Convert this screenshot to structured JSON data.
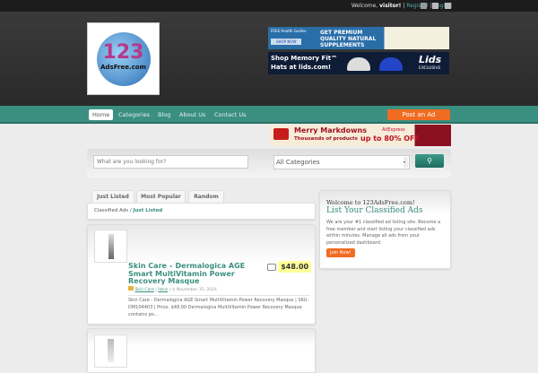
{
  "topbar": {
    "welcome": "Welcome,",
    "user": "visitor!",
    "register": "Register",
    "login": "Login",
    "sep": "|",
    "icons": [
      "rss-icon",
      "facebook-icon",
      "twitter-icon"
    ]
  },
  "logo": {
    "text_top": "123",
    "text_bottom": "AdsFree.com"
  },
  "ads": {
    "ad1_line1": "FREE Health Guides",
    "ad1_btn": "SHOP NOW",
    "ad1_main": "GET PREMIUM QUALITY NATURAL SUPPLEMENTS",
    "ad2_main": "Shop Memory Fit™ Hats at lids.com!",
    "ad2_brand": "Lids",
    "ad2_sub": "EXCLUSIVE",
    "banner_title": "Merry Markdowns",
    "banner_sub": "Thousands of products",
    "banner_offer": "up to 80% OFF",
    "banner_brand": "AliExpress"
  },
  "nav": {
    "items": [
      "Home",
      "Categories",
      "Blog",
      "About Us",
      "Contact Us"
    ],
    "post_ad": "Post an Ad"
  },
  "search": {
    "placeholder": "What are you looking for?",
    "category": "All Categories"
  },
  "tabs": [
    "Just Listed",
    "Most Popular",
    "Random"
  ],
  "breadcrumb": {
    "root": "Classified Ads",
    "sep": "/",
    "current": "Just Listed"
  },
  "listing": {
    "title": "Skin Care – Dermalogica AGE Smart MultiVitamin Power Recovery Masque",
    "price": "$48.00",
    "category": "Skin Care",
    "author": "lotus",
    "date": "November 15, 2014",
    "description": "Skin Care - Dermalogica AGE Smart MultiVitamin Power Recovery Masque | SKU: DM104403 | Price: $48.00 Dermalogica MultiVitamin Power Recovery Masque contains po..."
  },
  "sidebar": {
    "welcome": "Welcome to 123AdsFree.com!",
    "title": "List Your Classified Ads",
    "text": "We are your #1 classified ad listing site. Become a free member and start listing your classified ads within minutes. Manage all ads from your personalized dashboard.",
    "join": "Join Now!"
  },
  "colors": {
    "teal": "#3b8f80",
    "orange": "#f26b22",
    "price": "#ffff99"
  }
}
